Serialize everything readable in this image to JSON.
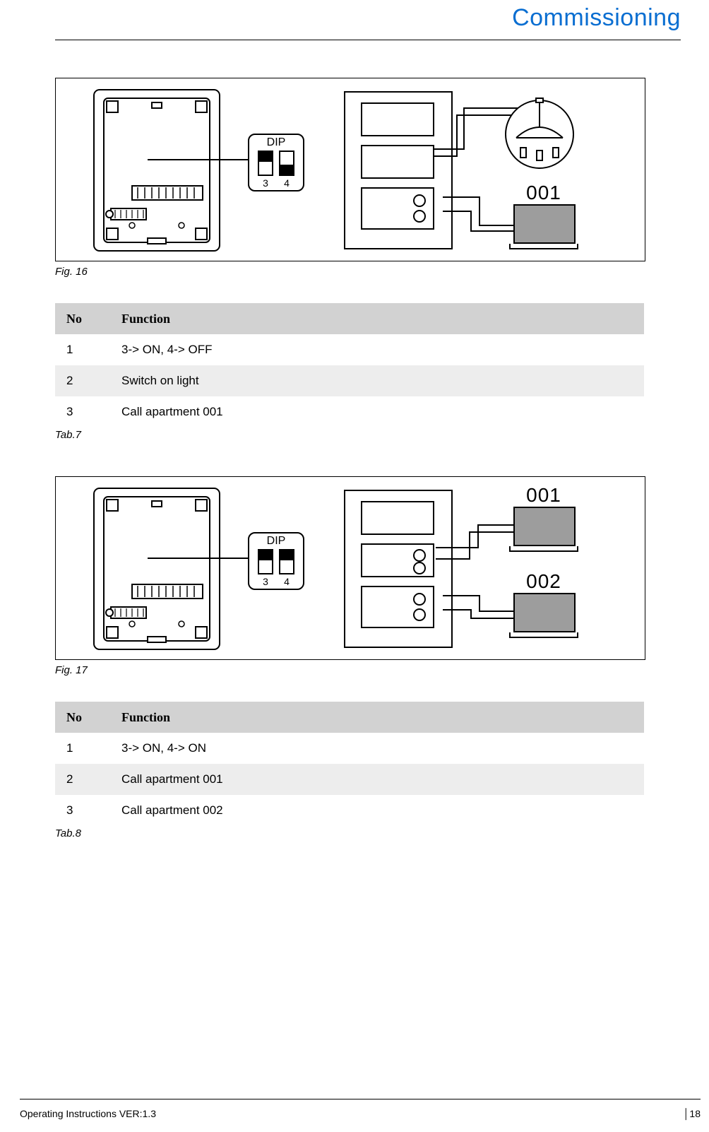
{
  "header": {
    "title": "Commissioning"
  },
  "fig16": {
    "caption": "Fig. 16",
    "dip": {
      "label": "DIP",
      "sw3_num": "3",
      "sw4_num": "4",
      "sw3_state": "ON",
      "sw4_state": "OFF"
    },
    "monitors": [
      {
        "label": "001"
      }
    ]
  },
  "tab7": {
    "header_no": "No",
    "header_fn": "Function",
    "caption": "Tab.7",
    "rows": [
      {
        "no": "1",
        "fn": "3-> ON, 4-> OFF"
      },
      {
        "no": "2",
        "fn": "Switch on light"
      },
      {
        "no": "3",
        "fn": "Call apartment 001"
      }
    ]
  },
  "fig17": {
    "caption": "Fig. 17",
    "dip": {
      "label": "DIP",
      "sw3_num": "3",
      "sw4_num": "4",
      "sw3_state": "ON",
      "sw4_state": "ON"
    },
    "monitors": [
      {
        "label": "001"
      },
      {
        "label": "002"
      }
    ]
  },
  "tab8": {
    "header_no": "No",
    "header_fn": "Function",
    "caption": "Tab.8",
    "rows": [
      {
        "no": "1",
        "fn": "3-> ON, 4-> ON"
      },
      {
        "no": "2",
        "fn": "Call apartment 001"
      },
      {
        "no": "3",
        "fn": "Call apartment 002"
      }
    ]
  },
  "footer": {
    "left": "Operating Instructions VER:1.3",
    "right": "│18"
  }
}
